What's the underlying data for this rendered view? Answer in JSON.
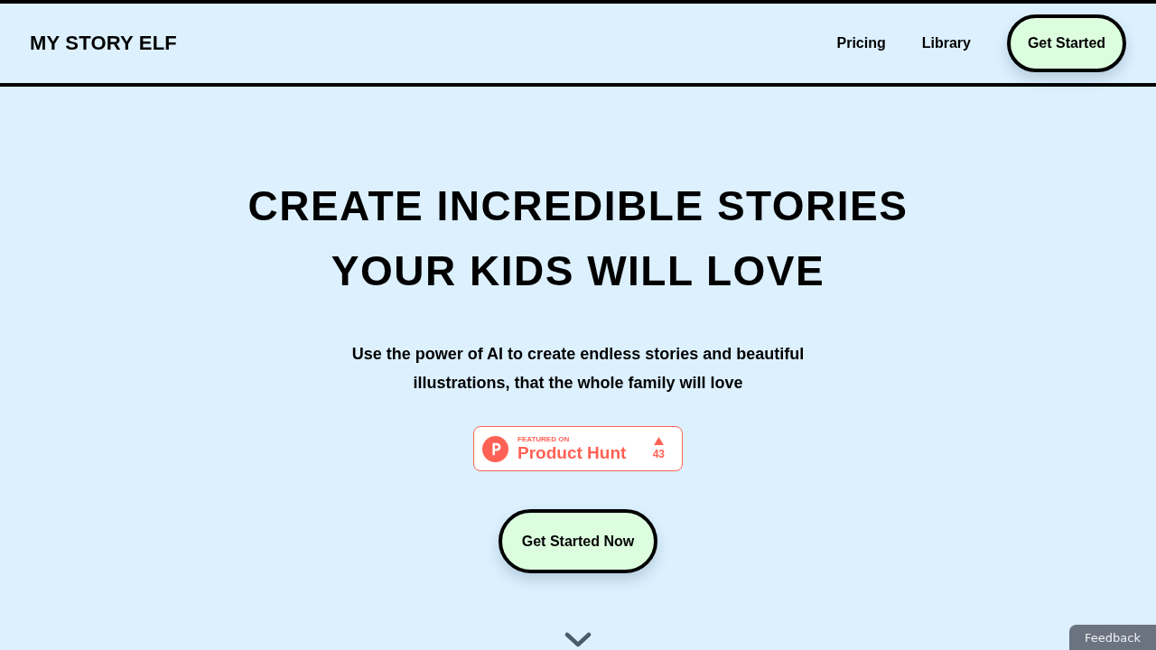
{
  "header": {
    "logo": "MY STORY ELF",
    "nav": [
      {
        "label": "Pricing"
      },
      {
        "label": "Library"
      }
    ],
    "cta": "Get Started"
  },
  "hero": {
    "title": "CREATE INCREDIBLE STORIES YOUR KIDS WILL LOVE",
    "subtitle": "Use the power of AI to create endless stories and beautiful illustrations, that the whole family will love",
    "badge": {
      "kicker": "FEATURED ON",
      "name": "Product Hunt",
      "votes": "43"
    },
    "cta": "Get Started Now"
  },
  "feedback_tab": "Feedback"
}
